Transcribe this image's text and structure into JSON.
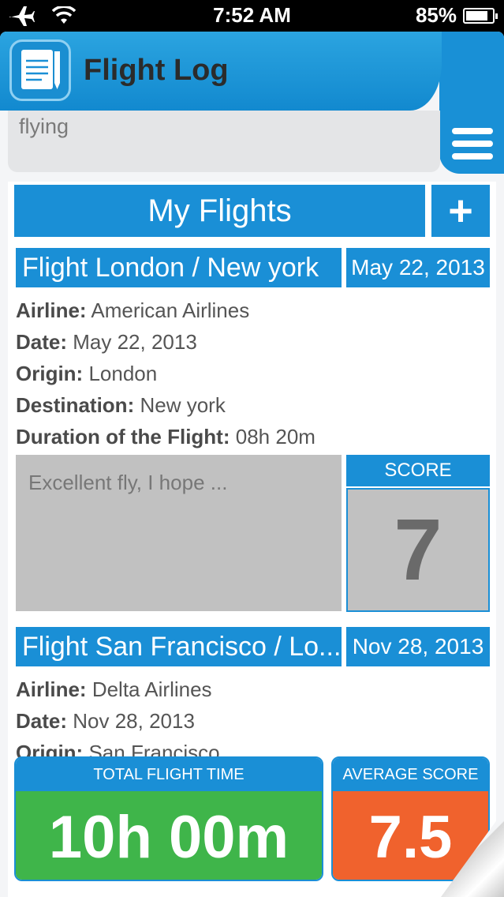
{
  "status_bar": {
    "time": "7:52 AM",
    "battery_text": "85%",
    "battery_level": 0.85,
    "icons": [
      "airplane-icon",
      "wifi-icon",
      "battery-icon"
    ]
  },
  "header": {
    "title": "Flight Log",
    "app_icon": "notebook-icon",
    "menu_icon": "hamburger-menu-icon"
  },
  "search": {
    "value": "flying"
  },
  "flights_section": {
    "title": "My Flights",
    "add_label": "+"
  },
  "flights": [
    {
      "title": "Flight London / New york",
      "date_badge": "May 22, 2013",
      "airline_label": "Airline:",
      "airline": "American Airlines",
      "date_label": "Date:",
      "date": "May 22, 2013",
      "origin_label": "Origin:",
      "origin": "London",
      "destination_label": "Destination:",
      "destination": "New york",
      "duration_label": "Duration of the Flight:",
      "duration": "08h 20m",
      "note": "Excellent fly, I hope ...",
      "score_label": "SCORE",
      "score": "7"
    },
    {
      "title": "Flight San Francisco / Lo...",
      "date_badge": "Nov 28, 2013",
      "airline_label": "Airline:",
      "airline": "Delta Airlines",
      "date_label": "Date:",
      "date": "Nov 28, 2013",
      "origin_label": "Origin:",
      "origin": "San Francisco"
    }
  ],
  "summary": {
    "total_label": "TOTAL FLIGHT TIME",
    "total_value": "10h 00m",
    "average_label": "AVERAGE SCORE",
    "average_value": "7.5"
  },
  "colors": {
    "primary": "#1a8fd6",
    "total_green": "#3fb54a",
    "average_orange": "#f0622d",
    "note_gray": "#c1c1c1"
  }
}
